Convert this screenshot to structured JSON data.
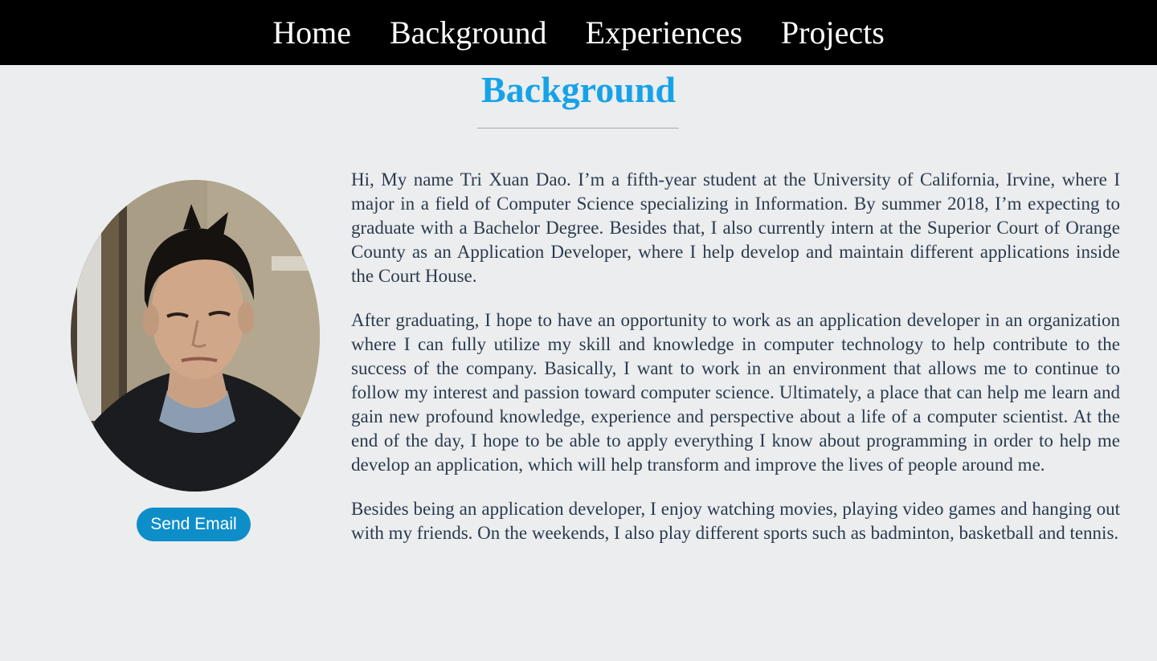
{
  "nav": {
    "items": [
      {
        "label": "Home"
      },
      {
        "label": "Background"
      },
      {
        "label": "Experiences"
      },
      {
        "label": "Projects"
      }
    ]
  },
  "page": {
    "title": "Background"
  },
  "profile": {
    "email_button_label": "Send Email"
  },
  "bio": {
    "paragraphs": [
      "Hi, My name Tri Xuan Dao. I’m a fifth-year student at the University of California, Irvine, where I major in a field of Computer Science specializing in Information. By summer 2018, I’m expecting to graduate with a Bachelor Degree. Besides that, I also currently intern at the Superior Court of Orange County as an Application Developer, where I help develop and maintain different applications inside the Court House.",
      "After graduating, I hope to have an opportunity to work as an application developer in an organization where I can fully utilize my skill and knowledge in computer technology to help contribute to the success of the company. Basically, I want to work in an environment that allows me to continue to follow my interest and passion toward computer science. Ultimately, a place that can help me learn and gain new profound knowledge, experience and perspective about a life of a computer scientist. At the end of the day, I hope to be able to apply everything I know about programming in order to help me develop an application, which will help transform and improve the lives of people around me.",
      "Besides being an application developer, I enjoy watching movies, playing video games and hanging out with my friends. On the weekends, I also play different sports such as badminton, basketball and tennis."
    ]
  },
  "colors": {
    "nav_background": "#000000",
    "page_background": "#ebedee",
    "title": "#17a2e8",
    "button": "#0e8ec9",
    "body_text": "#2b3a4d"
  }
}
